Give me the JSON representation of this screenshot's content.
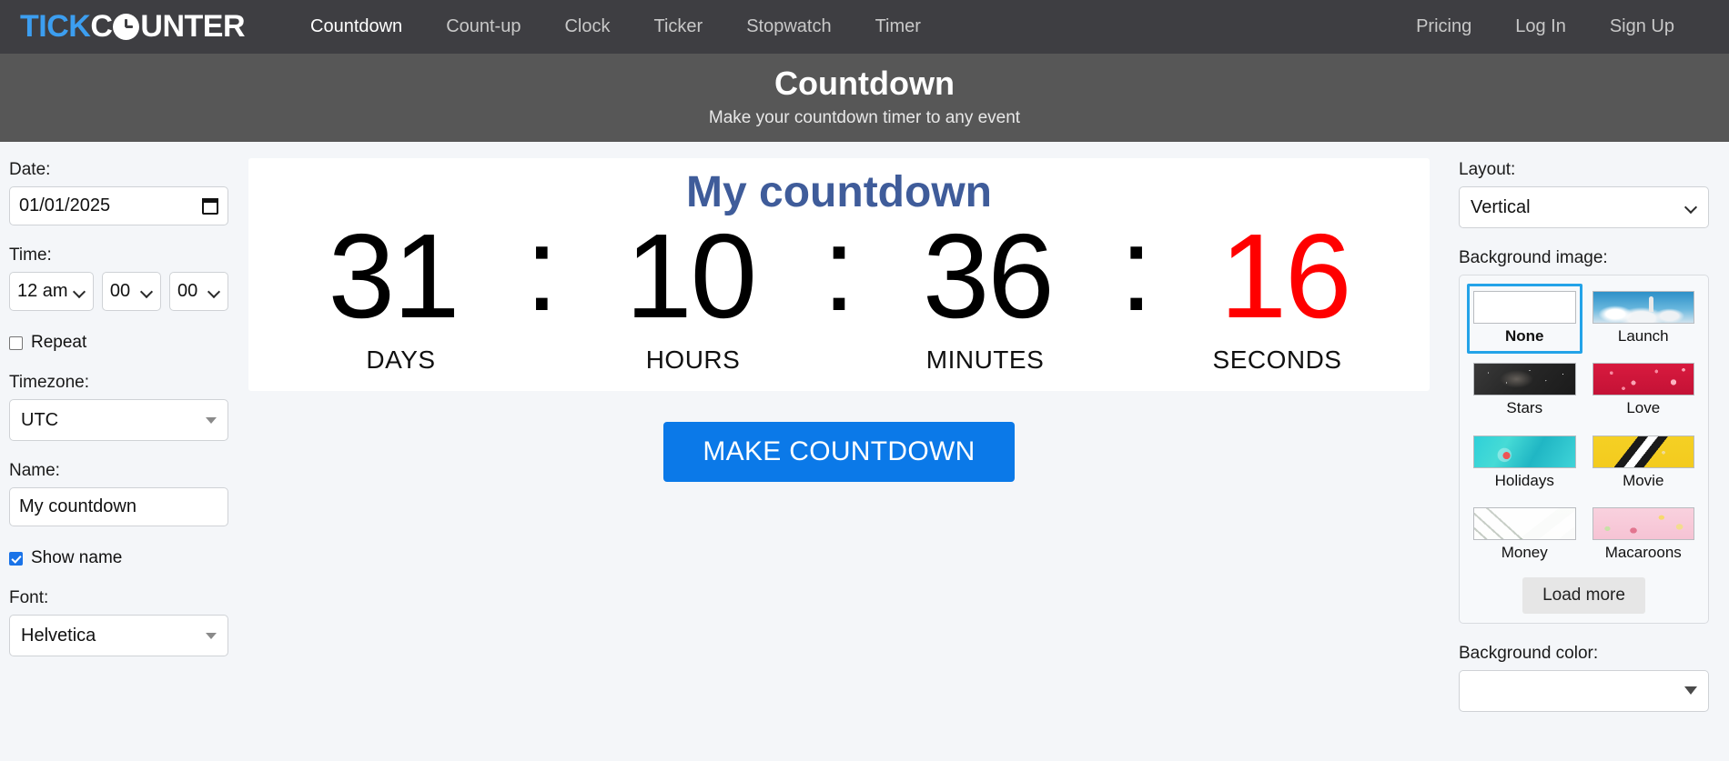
{
  "brand": {
    "part1": "TICK",
    "part2": "C",
    "part3": "UNTER",
    "clock_icon": "clock-icon"
  },
  "nav": {
    "left": [
      {
        "label": "Countdown",
        "active": true
      },
      {
        "label": "Count-up",
        "active": false
      },
      {
        "label": "Clock",
        "active": false
      },
      {
        "label": "Ticker",
        "active": false
      },
      {
        "label": "Stopwatch",
        "active": false
      },
      {
        "label": "Timer",
        "active": false
      }
    ],
    "right": [
      {
        "label": "Pricing"
      },
      {
        "label": "Log In"
      },
      {
        "label": "Sign Up"
      }
    ]
  },
  "banner": {
    "title": "Countdown",
    "subtitle": "Make your countdown timer to any event"
  },
  "left_panel": {
    "date_label": "Date:",
    "date_value": "01/01/2025",
    "time_label": "Time:",
    "time_hour": "12 am",
    "time_minute": "00",
    "time_second": "00",
    "repeat_label": "Repeat",
    "repeat_checked": false,
    "timezone_label": "Timezone:",
    "timezone_value": "UTC",
    "name_label": "Name:",
    "name_value": "My countdown",
    "show_name_label": "Show name",
    "show_name_checked": true,
    "font_label": "Font:",
    "font_value": "Helvetica"
  },
  "preview": {
    "title": "My countdown",
    "separator": ":",
    "units": [
      {
        "value": "31",
        "label": "DAYS",
        "color": "#000000"
      },
      {
        "value": "10",
        "label": "HOURS",
        "color": "#000000"
      },
      {
        "value": "36",
        "label": "MINUTES",
        "color": "#000000"
      },
      {
        "value": "16",
        "label": "SECONDS",
        "color": "#ff0000"
      }
    ]
  },
  "make_button": "MAKE COUNTDOWN",
  "right_panel": {
    "layout_label": "Layout:",
    "layout_value": "Vertical",
    "bg_image_label": "Background image:",
    "backgrounds": [
      {
        "name": "None",
        "selected": true,
        "thumb": "th-none"
      },
      {
        "name": "Launch",
        "selected": false,
        "thumb": "th-launch"
      },
      {
        "name": "Stars",
        "selected": false,
        "thumb": "th-stars"
      },
      {
        "name": "Love",
        "selected": false,
        "thumb": "th-love"
      },
      {
        "name": "Holidays",
        "selected": false,
        "thumb": "th-holidays"
      },
      {
        "name": "Movie",
        "selected": false,
        "thumb": "th-movie"
      },
      {
        "name": "Money",
        "selected": false,
        "thumb": "th-money"
      },
      {
        "name": "Macaroons",
        "selected": false,
        "thumb": "th-macaroons"
      }
    ],
    "load_more_label": "Load more",
    "bg_color_label": "Background color:",
    "bg_color_value": ""
  },
  "colors": {
    "nav_bg": "#3e3e42",
    "banner_bg": "#575757",
    "brand_blue": "#3c9ef0",
    "accent_button": "#0b79e8",
    "title_blue": "#3f5c9a",
    "seconds_red": "#ff0000",
    "selection_border": "#23a3e8",
    "page_bg": "#f4f6f9"
  }
}
